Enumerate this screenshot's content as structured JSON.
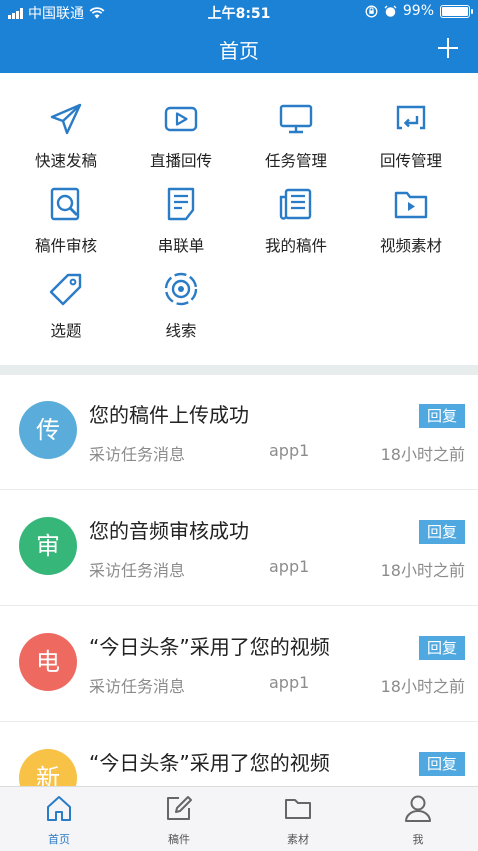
{
  "status_bar": {
    "carrier": "中国联通",
    "time": "上午8:51",
    "battery": "99%"
  },
  "nav": {
    "title": "首页"
  },
  "grid": [
    {
      "label": "快速发稿",
      "icon": "paper-plane-icon"
    },
    {
      "label": "直播回传",
      "icon": "play-icon"
    },
    {
      "label": "任务管理",
      "icon": "monitor-icon"
    },
    {
      "label": "回传管理",
      "icon": "return-screen-icon"
    },
    {
      "label": "稿件审核",
      "icon": "review-search-icon"
    },
    {
      "label": "串联单",
      "icon": "document-icon"
    },
    {
      "label": "我的稿件",
      "icon": "newspaper-icon"
    },
    {
      "label": "视频素材",
      "icon": "video-folder-icon"
    },
    {
      "label": "选题",
      "icon": "tag-icon"
    },
    {
      "label": "线索",
      "icon": "target-icon"
    }
  ],
  "messages": [
    {
      "avatar": "传",
      "color": "#5aaddb",
      "title": "您的稿件上传成功",
      "subtitle": "采访任务消息",
      "source": "app1",
      "time": "18小时之前",
      "reply": "回复"
    },
    {
      "avatar": "审",
      "color": "#37b679",
      "title": "您的音频审核成功",
      "subtitle": "采访任务消息",
      "source": "app1",
      "time": "18小时之前",
      "reply": "回复"
    },
    {
      "avatar": "电",
      "color": "#ee6a61",
      "title": "“今日头条”采用了您的视频",
      "subtitle": "采访任务消息",
      "source": "app1",
      "time": "18小时之前",
      "reply": "回复"
    },
    {
      "avatar": "新",
      "color": "#f7c246",
      "title": "“今日头条”采用了您的视频",
      "subtitle": "",
      "source": "",
      "time": "",
      "reply": "回复"
    }
  ],
  "tabbar": [
    {
      "label": "首页",
      "icon": "home-icon",
      "active": true
    },
    {
      "label": "稿件",
      "icon": "edit-icon",
      "active": false
    },
    {
      "label": "素材",
      "icon": "folder-icon",
      "active": false
    },
    {
      "label": "我",
      "icon": "user-icon",
      "active": false
    }
  ],
  "colors": {
    "primary": "#1b82d6",
    "icon_blue": "#2a7cc7",
    "tab_active": "#2a7cc7",
    "tab_inactive": "#666666"
  }
}
